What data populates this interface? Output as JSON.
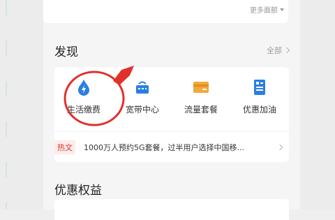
{
  "top_card": {
    "more_amount": "更多面额"
  },
  "discover": {
    "title": "发现",
    "all_label": "全部",
    "services": [
      {
        "label": "生活缴费",
        "icon": "lightning-drop-icon",
        "color": "#2b7fe0"
      },
      {
        "label": "宽带中心",
        "icon": "router-icon",
        "color": "#2b7fe0"
      },
      {
        "label": "流量套餐",
        "icon": "data-card-icon",
        "color": "#f2a93b"
      },
      {
        "label": "优惠加油",
        "icon": "fuel-station-icon",
        "color": "#2b7fe0"
      }
    ],
    "hot": {
      "tag": "热文",
      "text": "1000万人预约5G套餐，过半用户选择中国移..."
    }
  },
  "benefits": {
    "title": "优惠权益"
  },
  "colors": {
    "accent_blue": "#2b7fe0",
    "accent_orange": "#f2a93b",
    "hot_red": "#d23a2a",
    "annotation_red": "#e2302b"
  }
}
